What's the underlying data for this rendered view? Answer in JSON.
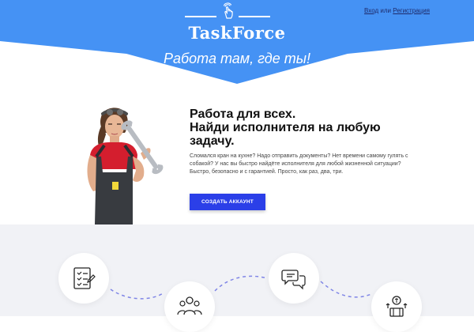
{
  "header": {
    "brand": "TaskForce",
    "tagline": "Работа там, где ты!",
    "login_label": "Вход",
    "or_label": "или",
    "register_label": "Регистрация",
    "band_color": "#4592f4"
  },
  "hero": {
    "title_line1": "Работа для всех.",
    "title_line2": "Найди исполнителя на любую",
    "title_line3": "задачу.",
    "description": "Сломался кран на кухне? Надо отправить документы? Нет времени самому гулять с собакой? У нас вы быстро найдёте исполнителя для любой жизненной ситуации? Быстро, безопасно и с гарантией. Просто, как раз, два, три.",
    "cta_label": "СОЗДАТЬ АККАУНТ",
    "cta_color": "#2b3fe8"
  },
  "steps": {
    "background": "#f1f2f6",
    "items": [
      {
        "icon": "checklist-icon"
      },
      {
        "icon": "team-icon"
      },
      {
        "icon": "chat-icon"
      },
      {
        "icon": "payment-icon"
      }
    ]
  }
}
